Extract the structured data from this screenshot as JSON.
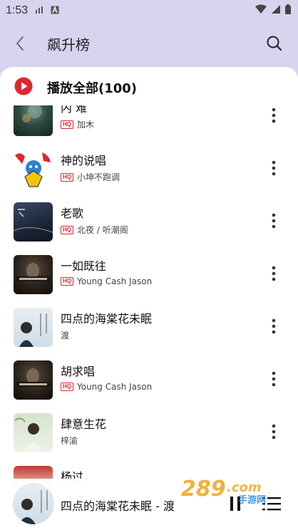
{
  "status": {
    "time": "1:53"
  },
  "header": {
    "title": "飙升榜"
  },
  "play_all": {
    "label": "播放全部(100)"
  },
  "songs": [
    {
      "title": "内 难",
      "artist": "加木",
      "hq": true
    },
    {
      "title": "神的说唱",
      "artist": "小坤不跑调",
      "hq": true
    },
    {
      "title": "老歌",
      "artist": "北夜 / 听潮阁",
      "hq": true
    },
    {
      "title": "一如既往",
      "artist": "Young Cash Jason",
      "hq": true
    },
    {
      "title": "四点的海棠花未眠",
      "artist": "渡",
      "hq": false
    },
    {
      "title": "胡求唱",
      "artist": "Young Cash Jason",
      "hq": true
    },
    {
      "title": "肆意生花",
      "artist": "梓渝",
      "hq": false
    },
    {
      "title": "杨过",
      "artist": "",
      "hq": false
    }
  ],
  "hq_label": "HQ",
  "now_playing": {
    "title": "四点的海棠花未眠 - 渡"
  },
  "watermark": {
    "text": "289",
    "sub": "手游网",
    "suffix": ".com"
  },
  "colors": {
    "accent": "#e0262d",
    "header_bg": "#d8d4ef"
  }
}
